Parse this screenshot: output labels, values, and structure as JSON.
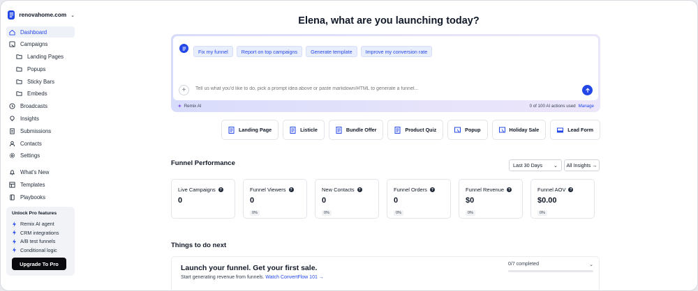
{
  "brand": {
    "name": "renovahome.com"
  },
  "sidebar": {
    "items": [
      {
        "label": "Dashboard",
        "icon": "home-icon",
        "active": true
      },
      {
        "label": "Campaigns",
        "icon": "campaign-icon"
      },
      {
        "label": "Landing Pages",
        "icon": "folder-icon",
        "sub": true
      },
      {
        "label": "Popups",
        "icon": "folder-icon",
        "sub": true
      },
      {
        "label": "Sticky Bars",
        "icon": "folder-icon",
        "sub": true
      },
      {
        "label": "Embeds",
        "icon": "folder-icon",
        "sub": true
      },
      {
        "label": "Broadcasts",
        "icon": "clock-icon"
      },
      {
        "label": "Insights",
        "icon": "lightbulb-icon"
      },
      {
        "label": "Submissions",
        "icon": "document-icon"
      },
      {
        "label": "Contacts",
        "icon": "user-icon"
      },
      {
        "label": "Settings",
        "icon": "gear-icon"
      },
      {
        "label": "What's New",
        "icon": "bell-icon"
      },
      {
        "label": "Templates",
        "icon": "template-icon"
      },
      {
        "label": "Playbooks",
        "icon": "book-icon"
      }
    ],
    "promo": {
      "title": "Unlock Pro features",
      "items": [
        "Remix AI agent",
        "CRM integrations",
        "A/B test funnels",
        "Conditional logic"
      ],
      "button": "Upgrade To Pro"
    }
  },
  "main": {
    "headline": "Elena, what are you launching today?",
    "prompt": {
      "chips": [
        "Fix my funnel",
        "Report on top campaigns",
        "Generate template",
        "Improve my conversion rate"
      ],
      "placeholder": "Tell us what you'd like to do, pick a prompt idea above or paste markdown/HTML to generate a funnel...",
      "remix_label": "Remix AI",
      "usage": "0 of 100 AI actions used",
      "manage": "Manage"
    },
    "templates": [
      "Landing Page",
      "Listicle",
      "Bundle Offer",
      "Product Quiz",
      "Popup",
      "Holiday Sale",
      "Lead Form"
    ],
    "performance": {
      "title": "Funnel Performance",
      "range": "Last 30 Days",
      "insights_button": "All Insights →",
      "cards": [
        {
          "label": "Live Campaigns",
          "value": "0"
        },
        {
          "label": "Funnel Viewers",
          "value": "0",
          "badge": "0%"
        },
        {
          "label": "New Contacts",
          "value": "0",
          "badge": "0%"
        },
        {
          "label": "Funnel Orders",
          "value": "0",
          "badge": "0%"
        },
        {
          "label": "Funnel Revenue",
          "value": "$0",
          "badge": "0%"
        },
        {
          "label": "Funnel AOV",
          "value": "$0.00",
          "badge": "0%"
        }
      ]
    },
    "todo": {
      "section_title": "Things to do next",
      "title": "Launch your funnel. Get your first sale.",
      "subtitle": "Start generating revenue from funnels.",
      "link": "Watch ConvertFlow 101 →",
      "progress_text": "0/7 completed",
      "progress_fraction": 0
    }
  },
  "colors": {
    "accent": "#2347e6",
    "dark": "#0b0b0f"
  }
}
